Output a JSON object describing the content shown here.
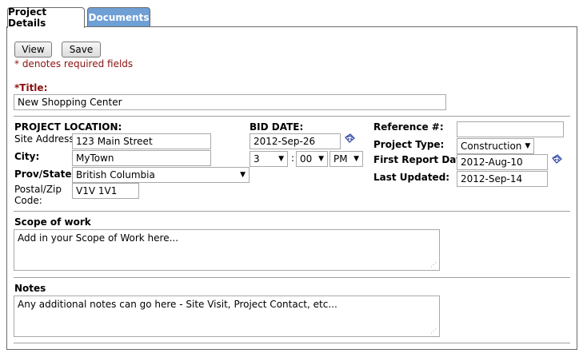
{
  "tabs": [
    {
      "label": "Project Details",
      "active": true
    },
    {
      "label": "Documents",
      "active": false
    }
  ],
  "toolbar": {
    "view_label": "View",
    "save_label": "Save"
  },
  "required_note": "* denotes required fields",
  "title_field": {
    "label": "*Title:",
    "value": "New Shopping Center"
  },
  "location": {
    "heading": "PROJECT LOCATION:",
    "site_address_label": "Site Address:",
    "site_address_value": "123 Main Street",
    "city_label": "City:",
    "city_value": "MyTown",
    "prov_label": "Prov/State:",
    "prov_value": "British Columbia",
    "postal_label_1": "Postal/Zip",
    "postal_label_2": "Code:",
    "postal_value": "V1V 1V1"
  },
  "bid": {
    "heading": "BID DATE:",
    "date_value": "2012-Sep-26",
    "hour": "3",
    "separator": ":",
    "minute": "00",
    "ampm": "PM"
  },
  "meta": {
    "reference_label": "Reference #:",
    "reference_value": "",
    "type_label": "Project Type:",
    "type_value": "Construction",
    "first_report_label": "First Report Date:",
    "first_report_value": "2012-Aug-10",
    "last_updated_label": "Last Updated:",
    "last_updated_value": "2012-Sep-14"
  },
  "scope": {
    "label": "Scope of work",
    "value": "Add in your Scope of Work here..."
  },
  "notes": {
    "label": "Notes",
    "value": "Any additional notes can go here - Site Visit, Project Contact, etc..."
  },
  "icons": {
    "calendar": "calendar-icon",
    "dropdown": "chevron-down-icon",
    "resize": "resize-grip-icon"
  },
  "colors": {
    "tab_inactive": "#6e9fd5",
    "required": "#8b1010"
  }
}
